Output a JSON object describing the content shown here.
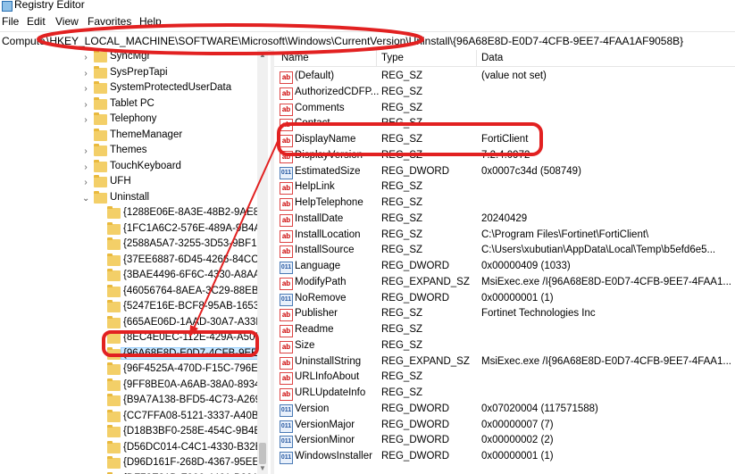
{
  "window": {
    "title": "Registry Editor",
    "icon": "regedit-icon"
  },
  "menubar": {
    "items": [
      "File",
      "Edit",
      "View",
      "Favorites",
      "Help"
    ]
  },
  "addressbar": {
    "label": "Compute",
    "path": "\\HKEY_LOCAL_MACHINE\\SOFTWARE\\Microsoft\\Windows\\CurrentVersion\\Uninstall\\{96A68E8D-E0D7-4CFB-9EE7-4FAA1AF9058B}"
  },
  "tree": {
    "items": [
      {
        "label": "SyncMgr",
        "expander": "›"
      },
      {
        "label": "SysPrepTapi",
        "expander": "›"
      },
      {
        "label": "SystemProtectedUserData",
        "expander": "›"
      },
      {
        "label": "Tablet PC",
        "expander": "›"
      },
      {
        "label": "Telephony",
        "expander": "›"
      },
      {
        "label": "ThemeManager",
        "expander": ""
      },
      {
        "label": "Themes",
        "expander": "›"
      },
      {
        "label": "TouchKeyboard",
        "expander": "›"
      },
      {
        "label": "UFH",
        "expander": "›"
      },
      {
        "label": "Uninstall",
        "expander": "⌄"
      }
    ],
    "uninstall_children": [
      "{1288E06E-8A3E-48B2-9AE8-D",
      "{1FC1A6C2-576E-489A-9B4A-9",
      "{2588A5A7-3255-3D53-9BF1-C",
      "{37EE6887-6D45-4266-84CC-A",
      "{3BAE4496-6F6C-4330-A8AA-E",
      "{46056764-8AEA-3C29-88EB-3",
      "{5247E16E-BCF8-95AB-1653-B",
      "{665AE06D-1AAD-30A7-A33F-",
      "{8EC4E0EC-112E-429A-A50D-E",
      "{96A68E8D-E0D7-4CFB-9EE7-4",
      "{96F4525A-470D-F15C-796E-50",
      "{9FF8BE0A-A6AB-38A0-8934-1",
      "{B9A7A138-BFD5-4C73-A269-F",
      "{CC7FFA08-5121-3337-A40B-2",
      "{D18B3BF0-258E-454C-9B4B-4",
      "{D56DC014-C4C1-4330-B32B-I",
      "{D96D161F-268D-4367-95EE-A",
      "{DF73E31D-F906-4461-B891-72"
    ],
    "selected_index": 9
  },
  "list": {
    "headers": {
      "name": "Name",
      "type": "Type",
      "data": "Data"
    },
    "rows": [
      {
        "name": "(Default)",
        "type": "REG_SZ",
        "data": "(value not set)",
        "icon": "string-value-icon"
      },
      {
        "name": "AuthorizedCDFP...",
        "type": "REG_SZ",
        "data": "",
        "icon": "string-value-icon"
      },
      {
        "name": "Comments",
        "type": "REG_SZ",
        "data": "",
        "icon": "string-value-icon"
      },
      {
        "name": "Contact",
        "type": "REG_SZ",
        "data": "",
        "icon": "string-value-icon"
      },
      {
        "name": "DisplayName",
        "type": "REG_SZ",
        "data": "FortiClient",
        "icon": "string-value-icon"
      },
      {
        "name": "DisplayVersion",
        "type": "REG_SZ",
        "data": "7.2.4.0972",
        "icon": "string-value-icon"
      },
      {
        "name": "EstimatedSize",
        "type": "REG_DWORD",
        "data": "0x0007c34d (508749)",
        "icon": "binary-value-icon"
      },
      {
        "name": "HelpLink",
        "type": "REG_SZ",
        "data": "",
        "icon": "string-value-icon"
      },
      {
        "name": "HelpTelephone",
        "type": "REG_SZ",
        "data": "",
        "icon": "string-value-icon"
      },
      {
        "name": "InstallDate",
        "type": "REG_SZ",
        "data": "20240429",
        "icon": "string-value-icon"
      },
      {
        "name": "InstallLocation",
        "type": "REG_SZ",
        "data": "C:\\Program Files\\Fortinet\\FortiClient\\",
        "icon": "string-value-icon"
      },
      {
        "name": "InstallSource",
        "type": "REG_SZ",
        "data": "C:\\Users\\xubutian\\AppData\\Local\\Temp\\b5efd6e5...",
        "icon": "string-value-icon"
      },
      {
        "name": "Language",
        "type": "REG_DWORD",
        "data": "0x00000409 (1033)",
        "icon": "binary-value-icon"
      },
      {
        "name": "ModifyPath",
        "type": "REG_EXPAND_SZ",
        "data": "MsiExec.exe /I{96A68E8D-E0D7-4CFB-9EE7-4FAA1...",
        "icon": "string-value-icon"
      },
      {
        "name": "NoRemove",
        "type": "REG_DWORD",
        "data": "0x00000001 (1)",
        "icon": "binary-value-icon"
      },
      {
        "name": "Publisher",
        "type": "REG_SZ",
        "data": "Fortinet Technologies Inc",
        "icon": "string-value-icon"
      },
      {
        "name": "Readme",
        "type": "REG_SZ",
        "data": "",
        "icon": "string-value-icon"
      },
      {
        "name": "Size",
        "type": "REG_SZ",
        "data": "",
        "icon": "string-value-icon"
      },
      {
        "name": "UninstallString",
        "type": "REG_EXPAND_SZ",
        "data": "MsiExec.exe /I{96A68E8D-E0D7-4CFB-9EE7-4FAA1...",
        "icon": "string-value-icon"
      },
      {
        "name": "URLInfoAbout",
        "type": "REG_SZ",
        "data": "",
        "icon": "string-value-icon"
      },
      {
        "name": "URLUpdateInfo",
        "type": "REG_SZ",
        "data": "",
        "icon": "string-value-icon"
      },
      {
        "name": "Version",
        "type": "REG_DWORD",
        "data": "0x07020004 (117571588)",
        "icon": "binary-value-icon"
      },
      {
        "name": "VersionMajor",
        "type": "REG_DWORD",
        "data": "0x00000007 (7)",
        "icon": "binary-value-icon"
      },
      {
        "name": "VersionMinor",
        "type": "REG_DWORD",
        "data": "0x00000002 (2)",
        "icon": "binary-value-icon"
      },
      {
        "name": "WindowsInstaller",
        "type": "REG_DWORD",
        "data": "0x00000001 (1)",
        "icon": "binary-value-icon"
      }
    ]
  },
  "annotation": {
    "color": "#e22121"
  }
}
